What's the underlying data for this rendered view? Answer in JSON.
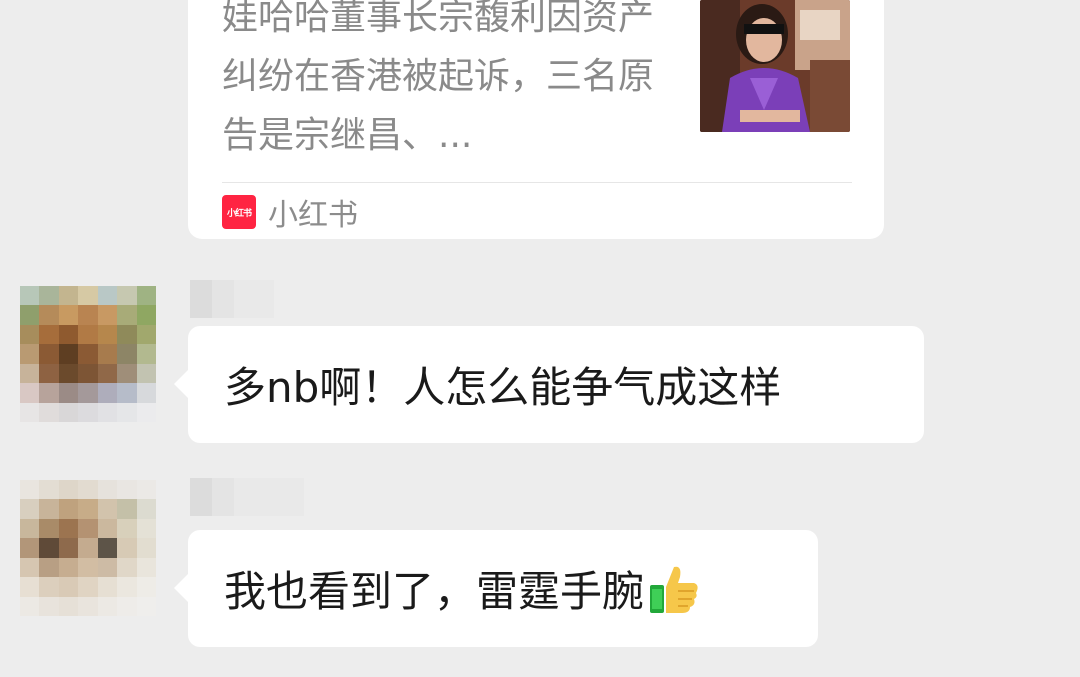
{
  "shared_card": {
    "description": "娃哈哈董事长宗馥利因资产纠纷在香港被起诉，三名原告是宗继昌、...",
    "source_name": "小红书",
    "source_icon_text": "小红书",
    "source_icon": "xiaohongshu-logo"
  },
  "messages": [
    {
      "text": "多nb啊！人怎么能争气成这样"
    },
    {
      "text": "我也看到了，雷霆手腕",
      "emoji": "thumbs-up-emoji"
    }
  ],
  "colors": {
    "background": "#ededed",
    "bubble": "#ffffff",
    "source_brand": "#ff2442"
  }
}
